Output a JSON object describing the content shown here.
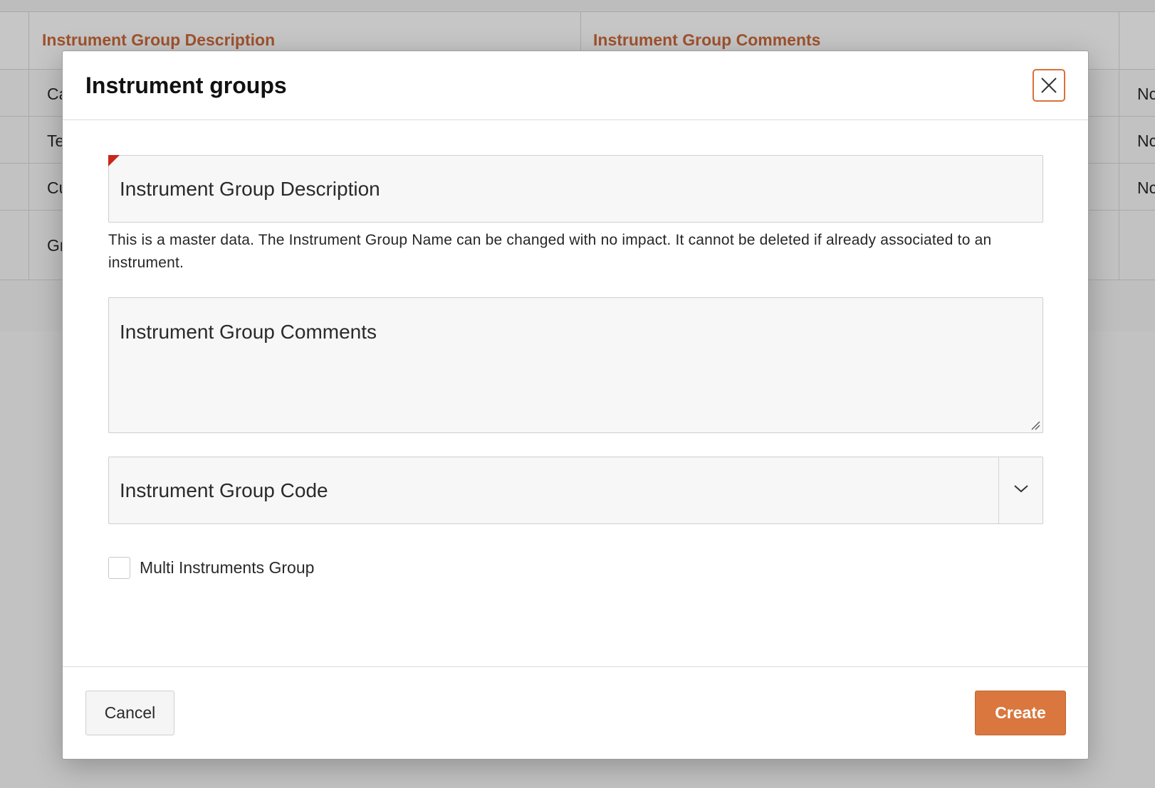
{
  "background": {
    "table": {
      "headers": [
        "Instrument Group Description",
        "Instrument Group Comments"
      ],
      "rows": [
        {
          "first_col_fragment": "Ca",
          "last_col_fragment": "Nc"
        },
        {
          "first_col_fragment": "Te",
          "last_col_fragment": "Nc"
        },
        {
          "first_col_fragment": "Cu",
          "last_col_fragment": "Nc"
        },
        {
          "first_col_fragment": "Gr",
          "last_col_fragment": ""
        }
      ]
    }
  },
  "modal": {
    "title": "Instrument groups",
    "close_icon": "close-icon",
    "fields": {
      "description": {
        "label": "Instrument Group Description",
        "required": true,
        "help_text": "This is a master data. The Instrument Group Name can be changed with no impact. It cannot be deleted if already associated to an instrument."
      },
      "comments": {
        "label": "Instrument Group Comments"
      },
      "code": {
        "label": "Instrument Group Code",
        "dropdown_icon": "chevron-down-icon"
      },
      "multi_group": {
        "label": "Multi Instruments Group",
        "checked": false
      }
    },
    "footer": {
      "cancel_label": "Cancel",
      "create_label": "Create"
    }
  },
  "colors": {
    "accent": "#d9773e",
    "header_text": "#a0522d",
    "required_flag": "#c9271c",
    "backdrop": "#c2c2c2"
  }
}
